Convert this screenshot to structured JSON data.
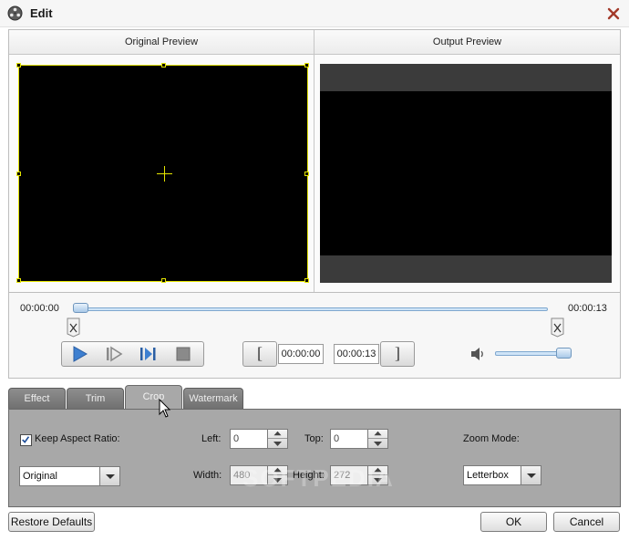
{
  "window": {
    "title": "Edit",
    "app_icon": "film-reel-icon",
    "close_icon": "close-icon"
  },
  "preview": {
    "original_label": "Original Preview",
    "output_label": "Output Preview"
  },
  "timeline": {
    "start_time": "00:00:00",
    "end_time": "00:00:13",
    "position_fraction": 0.0,
    "volume_fraction": 1.0,
    "trim_start_value": "00:00:00",
    "trim_end_value": "00:00:13",
    "set_start_label": "[",
    "set_end_label": "]",
    "controls": [
      "play-icon",
      "step-forward-icon",
      "next-frame-icon",
      "stop-icon"
    ],
    "volume_icon": "speaker-icon"
  },
  "tabs": [
    {
      "label": "Effect",
      "active": false
    },
    {
      "label": "Trim",
      "active": false
    },
    {
      "label": "Crop",
      "active": true
    },
    {
      "label": "Watermark",
      "active": false
    }
  ],
  "crop": {
    "keep_aspect_label": "Keep Aspect Ratio:",
    "keep_aspect_checked": true,
    "aspect_value": "Original",
    "left_label": "Left:",
    "left_value": "0",
    "top_label": "Top:",
    "top_value": "0",
    "width_label": "Width:",
    "width_value": "480",
    "height_label": "Height:",
    "height_value": "272",
    "zoom_label": "Zoom Mode:",
    "zoom_value": "Letterbox",
    "watermark_text": "SOFTPEDIA"
  },
  "footer": {
    "restore_label": "Restore Defaults",
    "ok_label": "OK",
    "cancel_label": "Cancel"
  },
  "colors": {
    "crop_frame": "#e4e400",
    "panel_gray": "#a8a8a8",
    "slider_blue": "#7fa8cf"
  }
}
